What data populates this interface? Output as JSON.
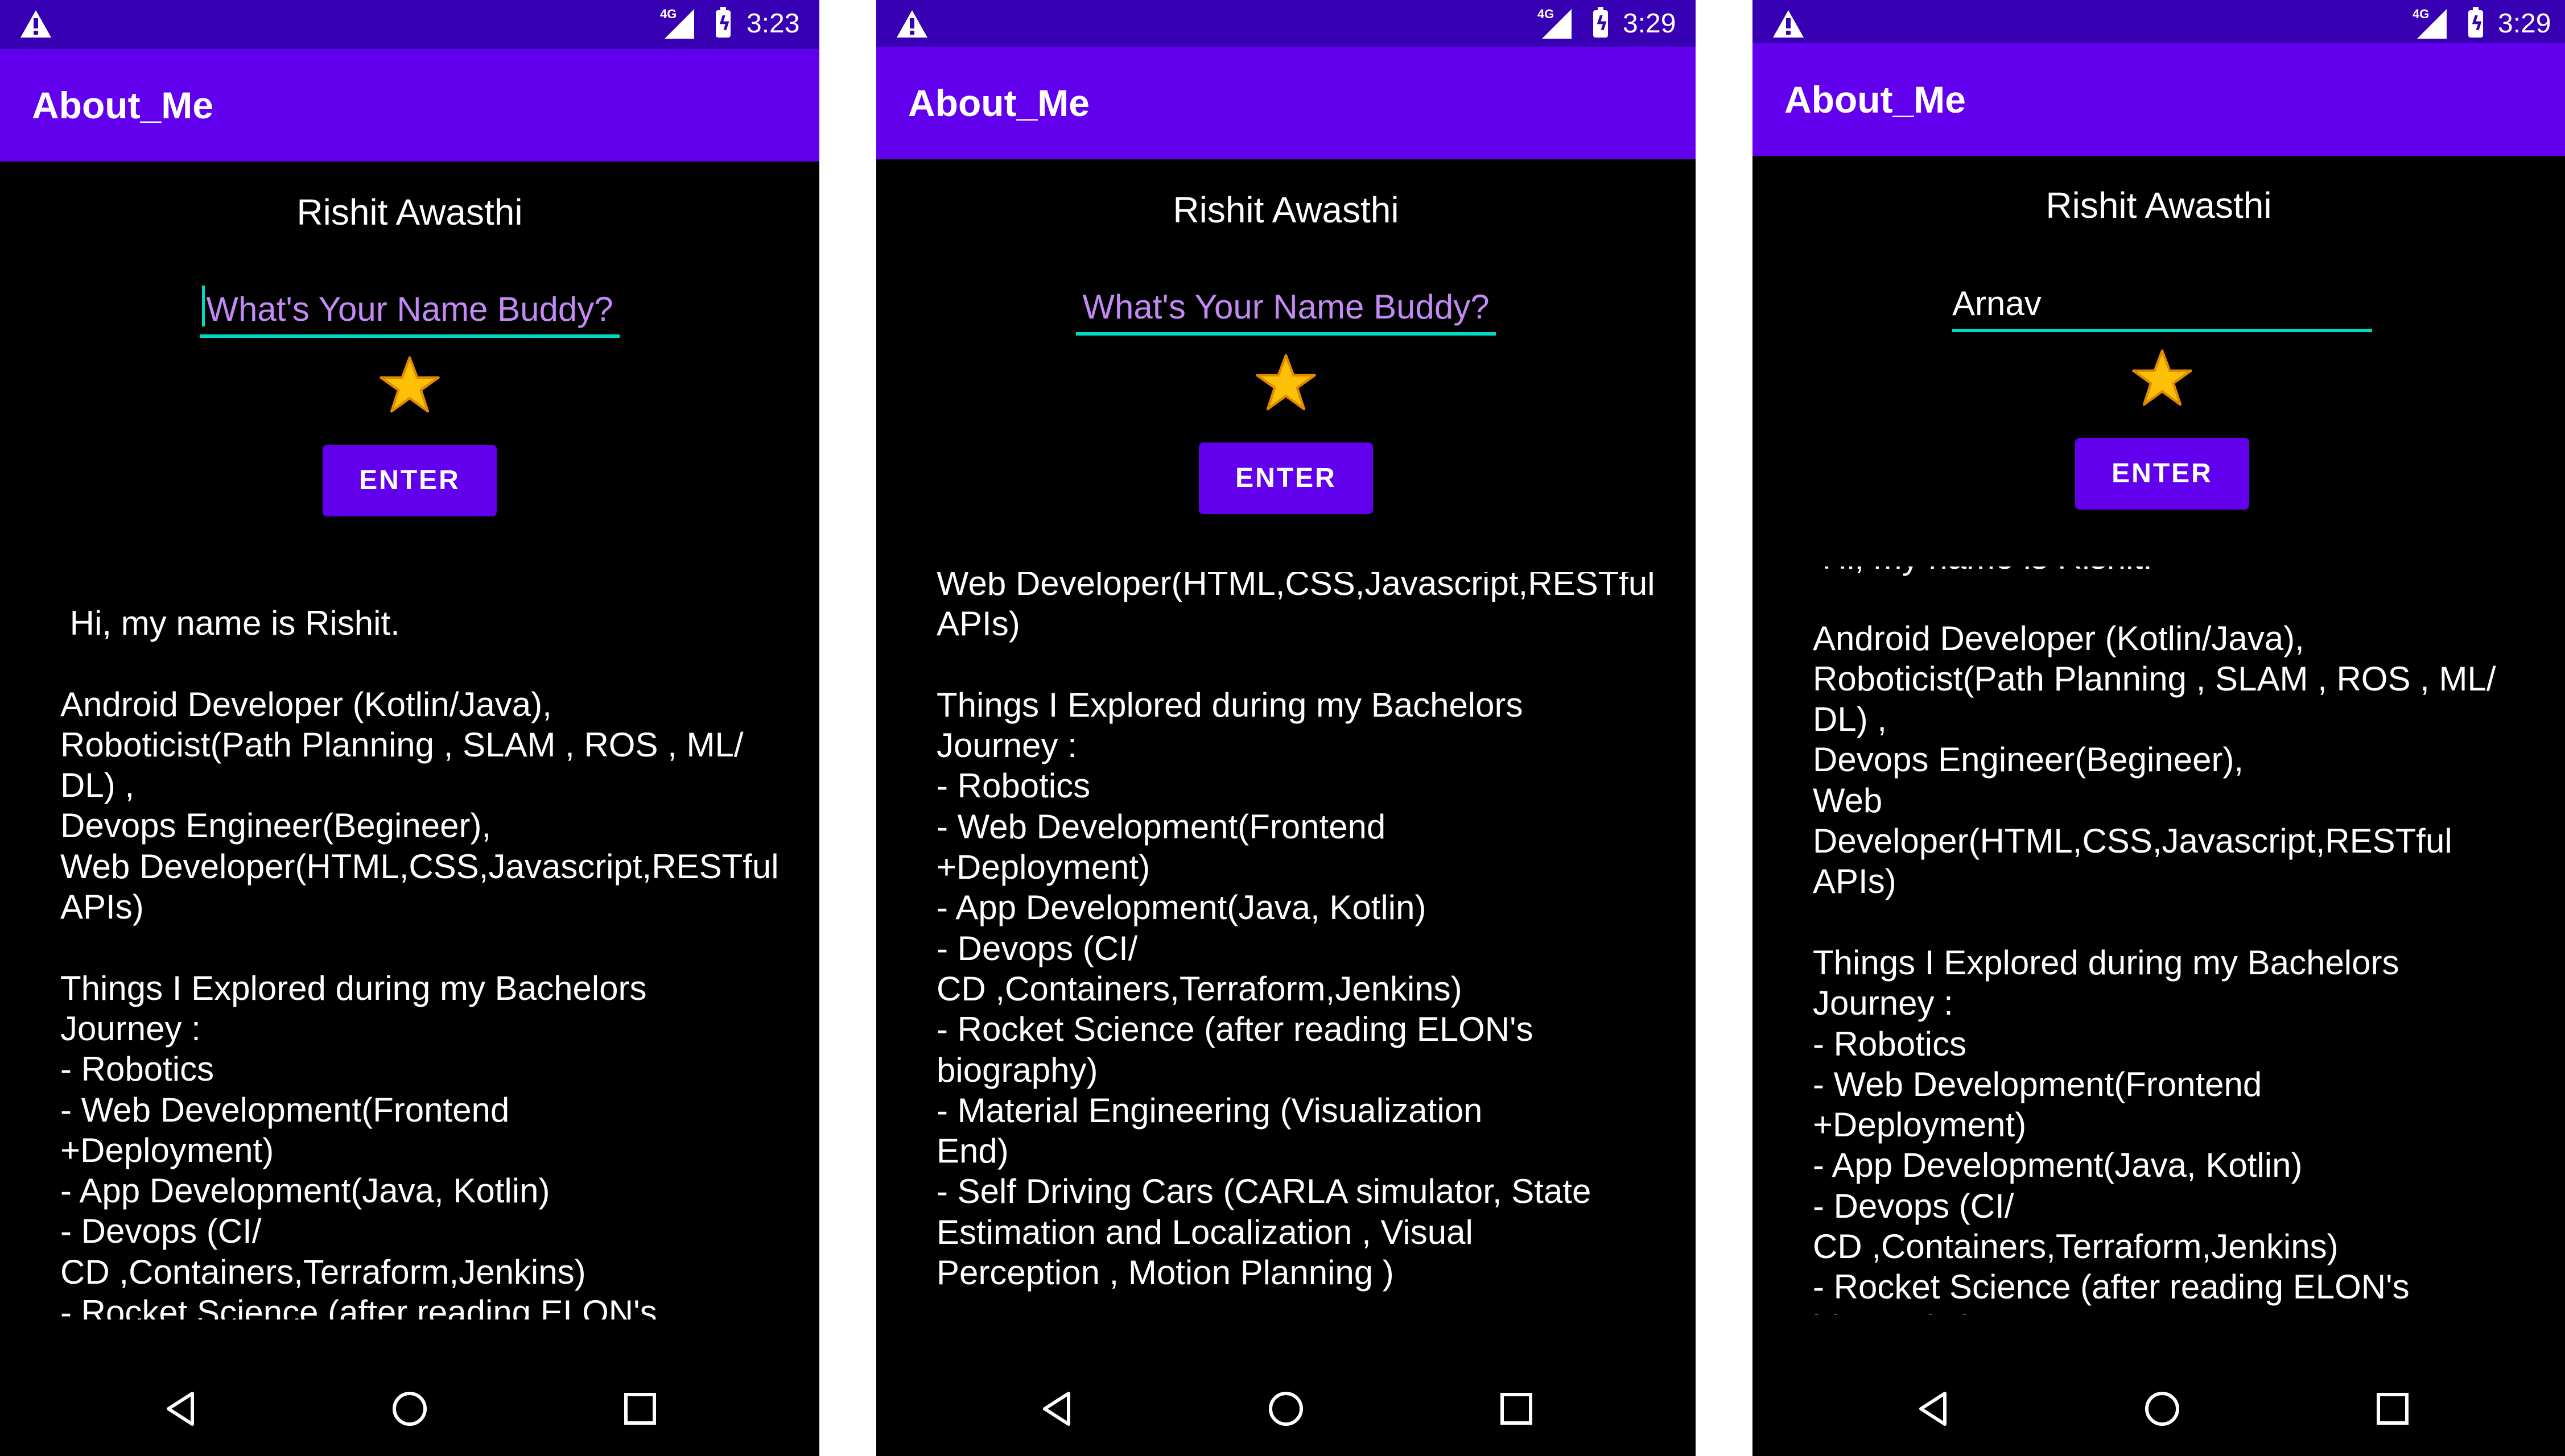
{
  "status_bar": {
    "network": "4G",
    "warning_icon": "warning-icon",
    "signal_icon": "signal-icon",
    "battery_icon": "battery-charging-icon"
  },
  "app": {
    "title": "About_Me"
  },
  "colors": {
    "status_bar": "#3700b3",
    "app_bar": "#6200ee",
    "button": "#6200ee",
    "underline": "#03dac5",
    "hint": "#c38af5",
    "background": "#000000",
    "star": "#ffc107"
  },
  "profile": {
    "name": "Rishit Awasthi",
    "star_icon": "star-icon"
  },
  "input": {
    "hint": "What's Your Name Buddy?"
  },
  "button": {
    "label": "ENTER"
  },
  "nav": {
    "back_icon": "back-icon",
    "home_icon": "home-icon",
    "recents_icon": "recents-icon"
  },
  "screens": [
    {
      "time": "3:23",
      "input_value": "",
      "body_text": " Hi, my name is Rishit.\n\nAndroid Developer (Kotlin/Java),\nRoboticist(Path Planning , SLAM , ROS , ML/\nDL) ,\nDevops Engineer(Begineer),\nWeb Developer(HTML,CSS,Javascript,RESTful\nAPIs)\n\nThings I Explored during my Bachelors\nJourney :\n- Robotics\n- Web Development(Frontend\n+Deployment)\n- App Development(Java, Kotlin)\n- Devops (CI/\nCD ,Containers,Terraform,Jenkins)\n- Rocket Science (after reading ELON's"
    },
    {
      "time": "3:29",
      "input_value": "",
      "body_text": "Web Developer(HTML,CSS,Javascript,RESTful\nAPIs)\n\nThings I Explored during my Bachelors\nJourney :\n- Robotics\n- Web Development(Frontend\n+Deployment)\n- App Development(Java, Kotlin)\n- Devops (CI/\nCD ,Containers,Terraform,Jenkins)\n- Rocket Science (after reading ELON's\nbiography)\n- Material Engineering (Visualization\nEnd)\n- Self Driving Cars (CARLA simulator, State\nEstimation and Localization , Visual\nPerception , Motion Planning )"
    },
    {
      "time": "3:29",
      "input_value": "Arnav",
      "body_text": " Hi, my name is Rishit.\n\nAndroid Developer (Kotlin/Java),\nRoboticist(Path Planning , SLAM , ROS , ML/\nDL) ,\nDevops Engineer(Begineer),\nWeb Developer(HTML,CSS,Javascript,RESTful\nAPIs)\n\nThings I Explored during my Bachelors\nJourney :\n- Robotics\n- Web Development(Frontend\n+Deployment)\n- App Development(Java, Kotlin)\n- Devops (CI/\nCD ,Containers,Terraform,Jenkins)\n- Rocket Science (after reading ELON's\nbiography)"
    }
  ]
}
